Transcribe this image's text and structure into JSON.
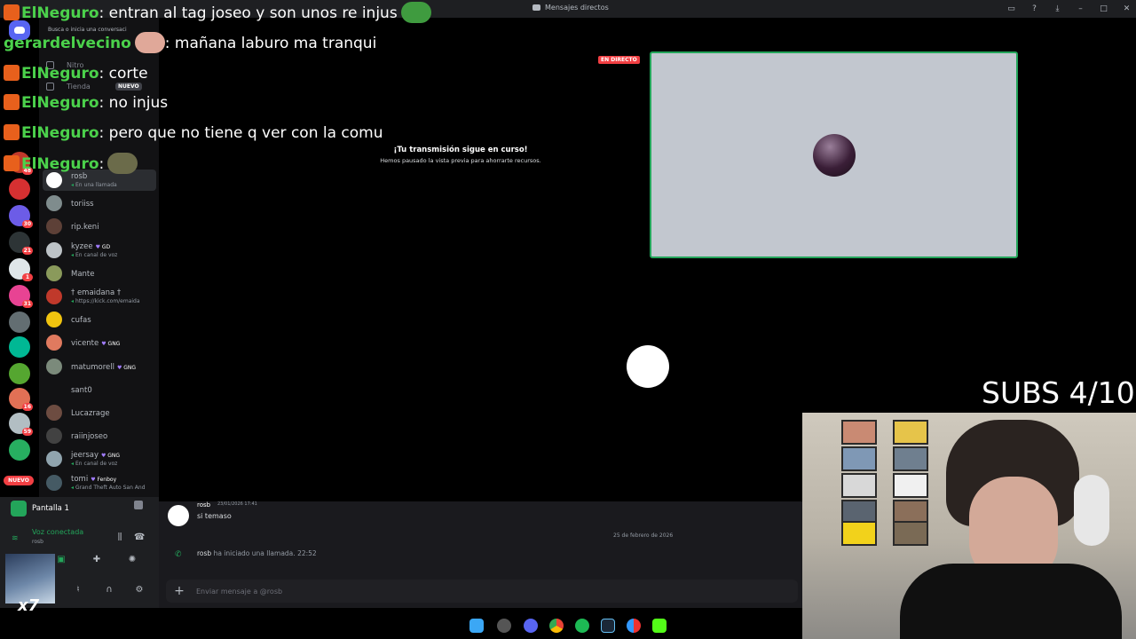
{
  "window": {
    "title": "Mensajes directos",
    "icons": [
      "inbox-icon",
      "help-icon",
      "download-icon",
      "minimize-icon",
      "maximize-icon",
      "close-icon"
    ]
  },
  "rail": {
    "servers": [
      {
        "badge": "48",
        "color": "#c0392b"
      },
      {
        "badge": "",
        "color": "#d63031"
      },
      {
        "badge": "30",
        "color": "#6c5ce7"
      },
      {
        "badge": "21",
        "color": "#2d3436"
      },
      {
        "badge": "1",
        "color": "#dfe6e9"
      },
      {
        "badge": "31",
        "color": "#e84393"
      },
      {
        "badge": "",
        "color": "#636e72"
      },
      {
        "badge": "",
        "color": "#00b894"
      },
      {
        "badge": "",
        "color": "#55a630"
      },
      {
        "badge": "16",
        "color": "#e17055"
      },
      {
        "badge": "59",
        "color": "#b2bec3"
      },
      {
        "badge": "",
        "color": "#27ae60"
      }
    ],
    "nuevo": "NUEVO"
  },
  "sidebar": {
    "search_placeholder": "Busca o inicia una conversaci",
    "nav": [
      {
        "label": "Nitro",
        "icon": "nitro-icon"
      },
      {
        "label": "Tienda",
        "icon": "shop-icon",
        "tag": "NUEVO"
      }
    ],
    "dms": [
      {
        "name": "rosb",
        "sub": "En una llamada",
        "color": "#ffffff",
        "active": true
      },
      {
        "name": "toriiss",
        "sub": "",
        "color": "#7f8c8d"
      },
      {
        "name": "rip.keni",
        "sub": "",
        "color": "#5d4037"
      },
      {
        "name": "kyzee",
        "tag": "GD",
        "sub": "En canal de voz",
        "color": "#bdc3c7"
      },
      {
        "name": "Mante",
        "sub": "",
        "color": "#8a9a5b"
      },
      {
        "name": "† emaidana †",
        "sub": "https://kick.com/emaida",
        "color": "#c0392b"
      },
      {
        "name": "cufas",
        "sub": "",
        "color": "#f1c40f"
      },
      {
        "name": "vicente",
        "tag": "GNG",
        "sub": "",
        "color": "#e07a5f"
      },
      {
        "name": "matumorell",
        "tag": "GNG",
        "sub": "",
        "color": "#7b8a7b"
      },
      {
        "name": "sant0",
        "sub": "",
        "color": "#121214"
      },
      {
        "name": "Lucazrage",
        "sub": "",
        "color": "#6d4c41"
      },
      {
        "name": "raiinjoseo",
        "sub": "",
        "color": "#424242"
      },
      {
        "name": "jeersay",
        "tag": "GNG",
        "sub": "En canal de voz",
        "color": "#90a4ae"
      },
      {
        "name": "tomi",
        "tag": "Fenboy",
        "sub": "Grand Theft Auto San And",
        "color": "#455a64"
      }
    ]
  },
  "panel": {
    "stream_label": "Pantalla 1",
    "voice_status": "Voz conectada",
    "voice_user": "rosb"
  },
  "stage": {
    "live_badge": "EN DIRECTO",
    "title": "¡Tu transmisión sigue en curso!",
    "subtitle": "Hemos pausado la vista previa para ahorrarte recursos."
  },
  "chat": {
    "author": "rosb",
    "timestamp": "23/01/2026 17:41",
    "message": "si temaso",
    "date_divider": "25 de febrero de 2026",
    "call_user": "rosb",
    "call_text": "ha iniciado una llamada.",
    "call_time": "22:52",
    "composer_placeholder": "Enviar mensaje a @rosb"
  },
  "overlay": {
    "lines": [
      {
        "user": "ElNeguro",
        "text": ": entran al tag joseo y son unos re injus",
        "emote": "#3f9b3f"
      },
      {
        "user": "gerardelvecino",
        "text": ": mañana laburo ma tranqui",
        "emote": "#e0a899",
        "prefix": "discord"
      },
      {
        "user": "ElNeguro",
        "text": ": corte"
      },
      {
        "user": "ElNeguro",
        "text": ": no injus"
      },
      {
        "user": "ElNeguro",
        "text": ": pero que no tiene q ver con la comu"
      },
      {
        "user": "ElNeguro",
        "text": ":",
        "emote": "#6b6b4a"
      }
    ],
    "subs": "SUBS 4/10"
  },
  "taskbar": {
    "apps": [
      "windows-start-icon",
      "nvidia-icon",
      "discord-app-icon",
      "chrome-icon",
      "spotify-icon",
      "steam-icon",
      "obs-icon",
      "kick-icon"
    ]
  }
}
